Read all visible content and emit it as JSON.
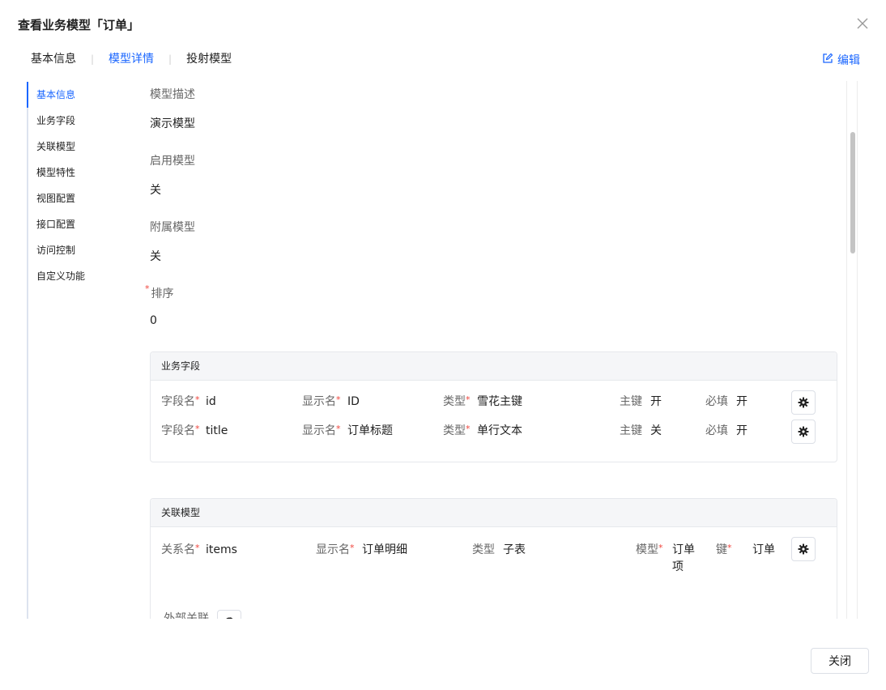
{
  "dialog": {
    "title": "查看业务模型「订单」"
  },
  "tabs": [
    {
      "label": "基本信息",
      "active": false
    },
    {
      "label": "模型详情",
      "active": true
    },
    {
      "label": "投射模型",
      "active": false
    }
  ],
  "edit_label": "编辑",
  "anchor_nav": [
    {
      "label": "基本信息",
      "active": true
    },
    {
      "label": "业务字段"
    },
    {
      "label": "关联模型"
    },
    {
      "label": "模型特性"
    },
    {
      "label": "视图配置"
    },
    {
      "label": "接口配置"
    },
    {
      "label": "访问控制"
    },
    {
      "label": "自定义功能"
    }
  ],
  "fields": {
    "description": {
      "label": "模型描述",
      "value": "演示模型"
    },
    "enabled": {
      "label": "启用模型",
      "value": "关"
    },
    "attached": {
      "label": "附属模型",
      "value": "关"
    },
    "sort": {
      "label": "排序",
      "value": "0",
      "required": true
    }
  },
  "business_fields": {
    "title": "业务字段",
    "labels": {
      "field_name": "字段名",
      "display_name": "显示名",
      "type": "类型",
      "primary_key": "主键",
      "required": "必填"
    },
    "rows": [
      {
        "field_name": "id",
        "display_name": "ID",
        "type": "雪花主键",
        "primary_key": "开",
        "required": "开"
      },
      {
        "field_name": "title",
        "display_name": "订单标题",
        "type": "单行文本",
        "primary_key": "关",
        "required": "开"
      }
    ]
  },
  "related_models": {
    "title": "关联模型",
    "labels": {
      "relation_name": "关系名",
      "display_name": "显示名",
      "type": "类型",
      "model": "模型",
      "key": "键"
    },
    "rows": [
      {
        "relation_name": "items",
        "display_name": "订单明细",
        "type": "子表",
        "model": "订单项",
        "key": "订单"
      }
    ],
    "external_label": "外部关联"
  },
  "footer": {
    "close_label": "关闭"
  },
  "colors": {
    "accent": "#1a66ff",
    "required": "#f0443c"
  }
}
